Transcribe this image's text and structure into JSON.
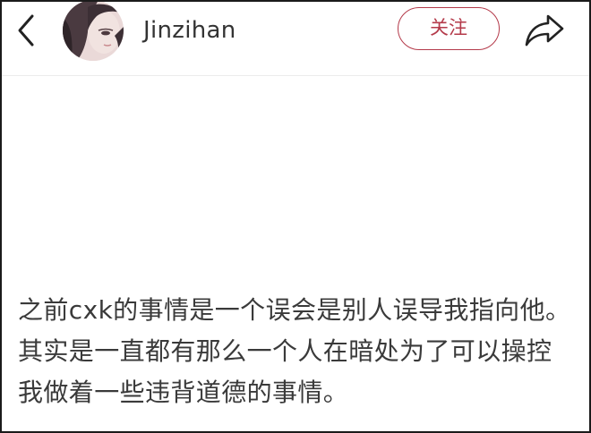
{
  "header": {
    "back_icon": "chevron-left-icon",
    "avatar_alt": "avatar",
    "username": "Jinzihan",
    "follow_label": "关注",
    "share_icon": "share-arrow-icon"
  },
  "post": {
    "text": "之前cxk的事情是一个误会是别人误导我指向他。其实是一直都有那么一个人在暗处为了可以操控我做着一些违背道德的事情。"
  },
  "colors": {
    "accent": "#b43a4a",
    "text": "#3a3a3a",
    "border": "#1a1a1a"
  }
}
